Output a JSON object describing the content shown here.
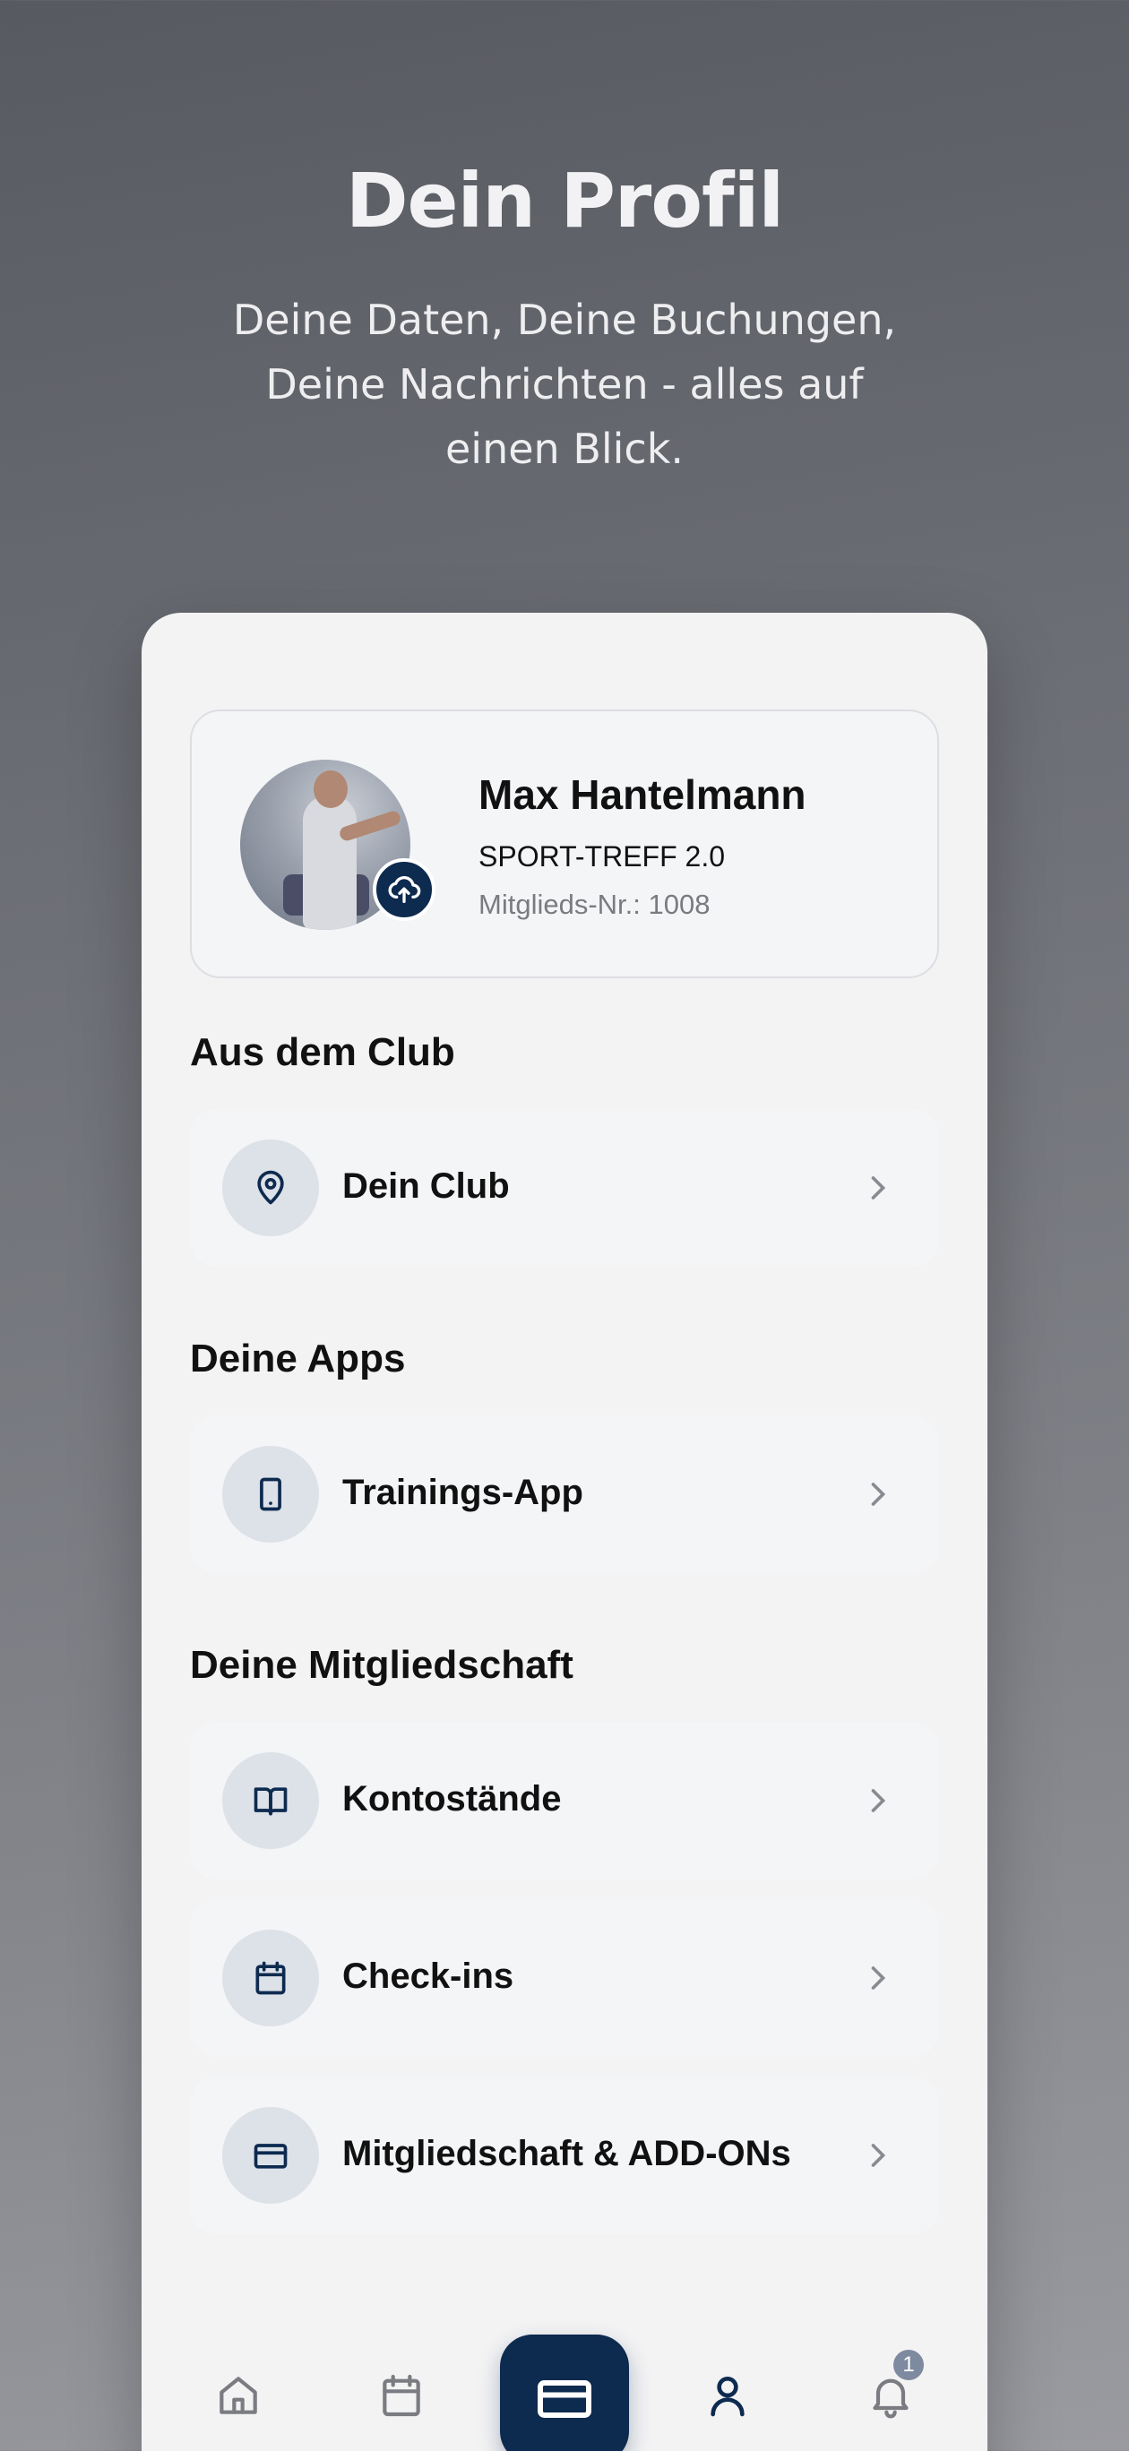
{
  "hero": {
    "title": "Dein Profil",
    "subtitle": "Deine Daten, Deine Buchungen, Deine Nachrichten - alles auf einen Blick."
  },
  "profile": {
    "name": "Max Hantelmann",
    "club": "SPORT-TREFF 2.0",
    "member_no": "Mitglieds-Nr.: 1008"
  },
  "sections": {
    "club": {
      "title": "Aus dem Club",
      "items": [
        {
          "label": "Dein Club",
          "icon": "location-pin-icon"
        }
      ]
    },
    "apps": {
      "title": "Deine Apps",
      "items": [
        {
          "label": "Trainings-App",
          "icon": "smartphone-icon"
        }
      ]
    },
    "membership": {
      "title": "Deine Mitgliedschaft",
      "items": [
        {
          "label": "Kontostände",
          "icon": "book-icon"
        },
        {
          "label": "Check-ins",
          "icon": "calendar-icon"
        },
        {
          "label": "Mitgliedschaft & ADD-ONs",
          "icon": "card-icon"
        }
      ]
    }
  },
  "tabbar": {
    "items": [
      "home-icon",
      "calendar-icon",
      "card-icon",
      "user-icon",
      "bell-icon"
    ],
    "notification_count": "1"
  },
  "colors": {
    "accent": "#0d2a4f",
    "icon_bg": "#dde1e8",
    "card_bg": "#f4f5f7"
  }
}
